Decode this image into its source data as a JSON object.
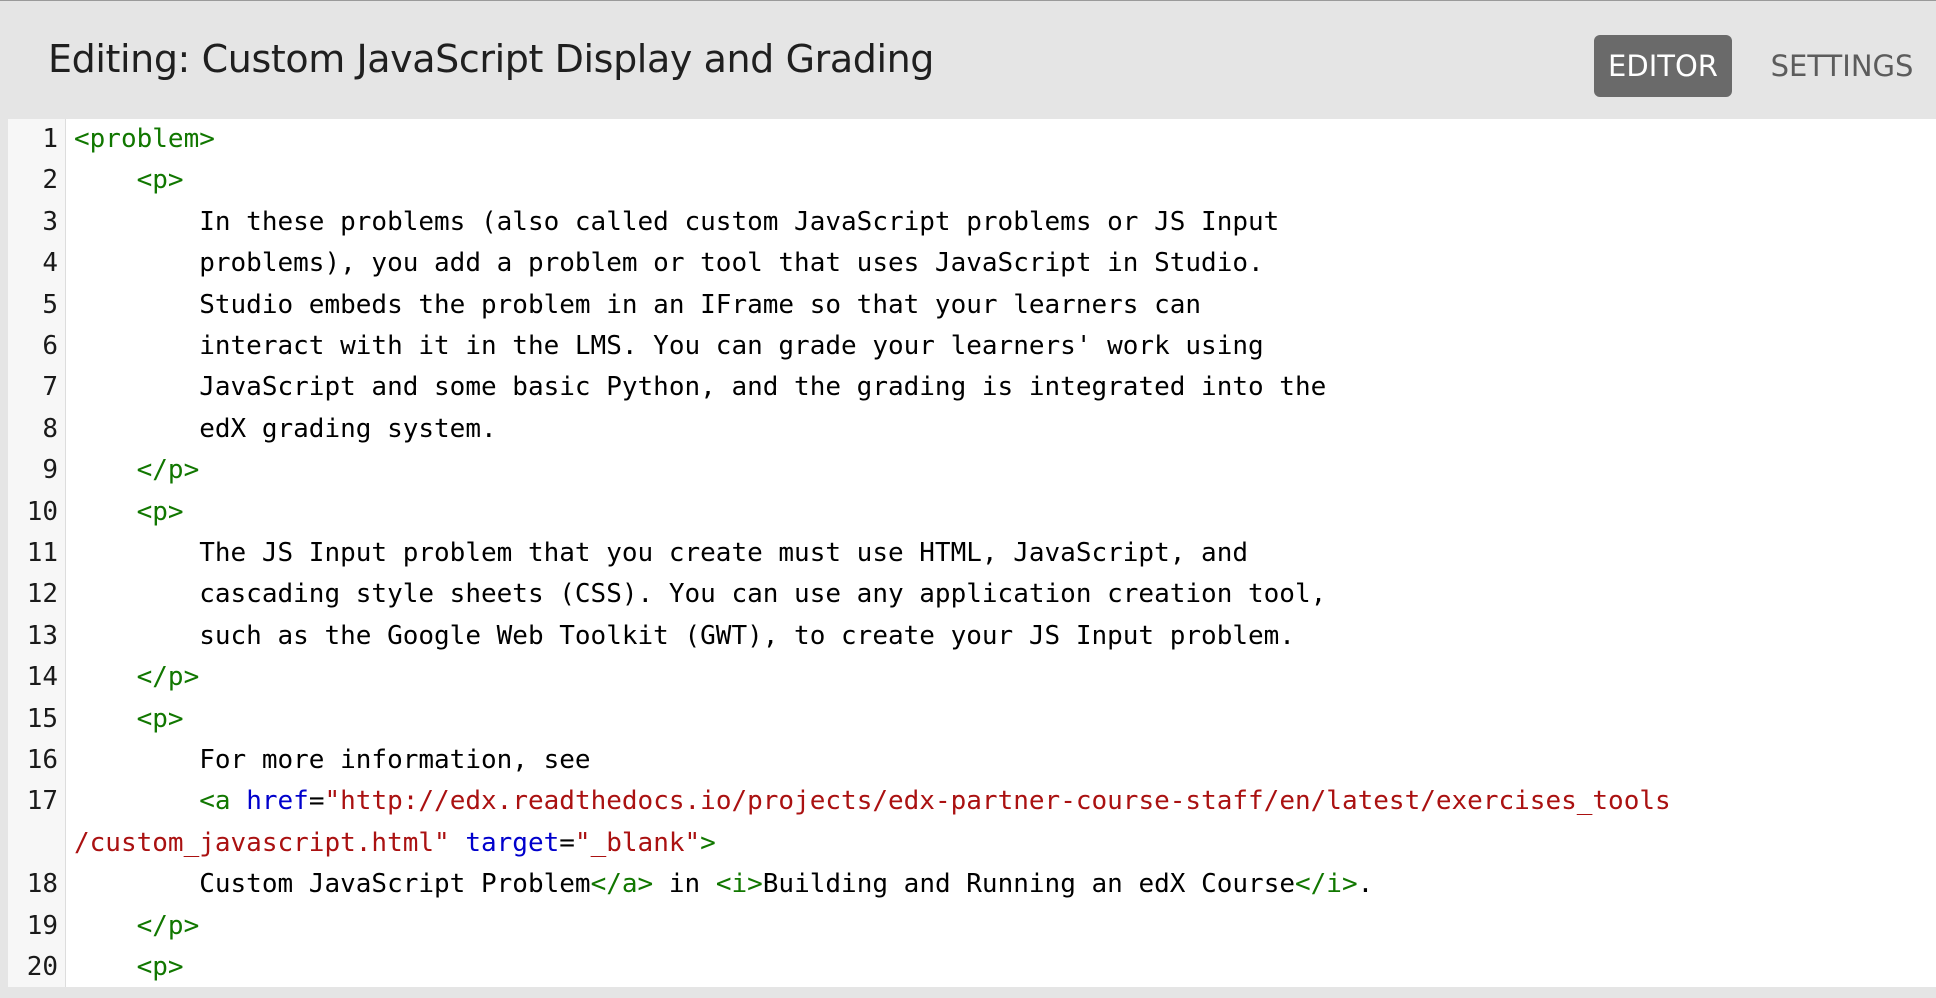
{
  "header": {
    "title": "Editing: Custom JavaScript Display and Grading",
    "editor_tab": "EDITOR",
    "settings_tab": "SETTINGS"
  },
  "colors": {
    "tag": "#117700",
    "attribute": "#0000cc",
    "string": "#aa1111",
    "text": "#000000",
    "active_tab_bg": "#6a6a6a",
    "header_bg": "#e5e5e5"
  },
  "lines": [
    {
      "num": "1",
      "tokens": [
        {
          "t": "tag",
          "v": "<problem>"
        }
      ]
    },
    {
      "num": "2",
      "tokens": [
        {
          "t": "text",
          "v": "    "
        },
        {
          "t": "tag",
          "v": "<p>"
        }
      ]
    },
    {
      "num": "3",
      "tokens": [
        {
          "t": "text",
          "v": "        In these problems (also called custom JavaScript problems or JS Input"
        }
      ]
    },
    {
      "num": "4",
      "tokens": [
        {
          "t": "text",
          "v": "        problems), you add a problem or tool that uses JavaScript in Studio."
        }
      ]
    },
    {
      "num": "5",
      "tokens": [
        {
          "t": "text",
          "v": "        Studio embeds the problem in an IFrame so that your learners can"
        }
      ]
    },
    {
      "num": "6",
      "tokens": [
        {
          "t": "text",
          "v": "        interact with it in the LMS. You can grade your learners' work using"
        }
      ]
    },
    {
      "num": "7",
      "tokens": [
        {
          "t": "text",
          "v": "        JavaScript and some basic Python, and the grading is integrated into the"
        }
      ]
    },
    {
      "num": "8",
      "tokens": [
        {
          "t": "text",
          "v": "        edX grading system."
        }
      ]
    },
    {
      "num": "9",
      "tokens": [
        {
          "t": "text",
          "v": "    "
        },
        {
          "t": "tag",
          "v": "</p>"
        }
      ]
    },
    {
      "num": "10",
      "tokens": [
        {
          "t": "text",
          "v": "    "
        },
        {
          "t": "tag",
          "v": "<p>"
        }
      ]
    },
    {
      "num": "11",
      "tokens": [
        {
          "t": "text",
          "v": "        The JS Input problem that you create must use HTML, JavaScript, and"
        }
      ]
    },
    {
      "num": "12",
      "tokens": [
        {
          "t": "text",
          "v": "        cascading style sheets (CSS). You can use any application creation tool,"
        }
      ]
    },
    {
      "num": "13",
      "tokens": [
        {
          "t": "text",
          "v": "        such as the Google Web Toolkit (GWT), to create your JS Input problem."
        }
      ]
    },
    {
      "num": "14",
      "tokens": [
        {
          "t": "text",
          "v": "    "
        },
        {
          "t": "tag",
          "v": "</p>"
        }
      ]
    },
    {
      "num": "15",
      "tokens": [
        {
          "t": "text",
          "v": "    "
        },
        {
          "t": "tag",
          "v": "<p>"
        }
      ]
    },
    {
      "num": "16",
      "tokens": [
        {
          "t": "text",
          "v": "        For more information, see"
        }
      ]
    },
    {
      "num": "17",
      "tokens": [
        {
          "t": "text",
          "v": "        "
        },
        {
          "t": "tag",
          "v": "<a "
        },
        {
          "t": "attr",
          "v": "href"
        },
        {
          "t": "text",
          "v": "="
        },
        {
          "t": "str",
          "v": "\"http://edx.readthedocs.io/projects/edx-partner-course-staff/en/latest/exercises_tools"
        }
      ]
    },
    {
      "num": "",
      "tokens": [
        {
          "t": "str",
          "v": "/custom_javascript.html\""
        },
        {
          "t": "text",
          "v": " "
        },
        {
          "t": "attr",
          "v": "target"
        },
        {
          "t": "text",
          "v": "="
        },
        {
          "t": "str",
          "v": "\"_blank\""
        },
        {
          "t": "tag",
          "v": ">"
        }
      ]
    },
    {
      "num": "18",
      "tokens": [
        {
          "t": "text",
          "v": "        Custom JavaScript Problem"
        },
        {
          "t": "tag",
          "v": "</a>"
        },
        {
          "t": "text",
          "v": " in "
        },
        {
          "t": "tag",
          "v": "<i>"
        },
        {
          "t": "text",
          "v": "Building and Running an edX Course"
        },
        {
          "t": "tag",
          "v": "</i>"
        },
        {
          "t": "text",
          "v": "."
        }
      ]
    },
    {
      "num": "19",
      "tokens": [
        {
          "t": "text",
          "v": "    "
        },
        {
          "t": "tag",
          "v": "</p>"
        }
      ]
    },
    {
      "num": "20",
      "tokens": [
        {
          "t": "text",
          "v": "    "
        },
        {
          "t": "tag",
          "v": "<p>"
        }
      ]
    }
  ]
}
